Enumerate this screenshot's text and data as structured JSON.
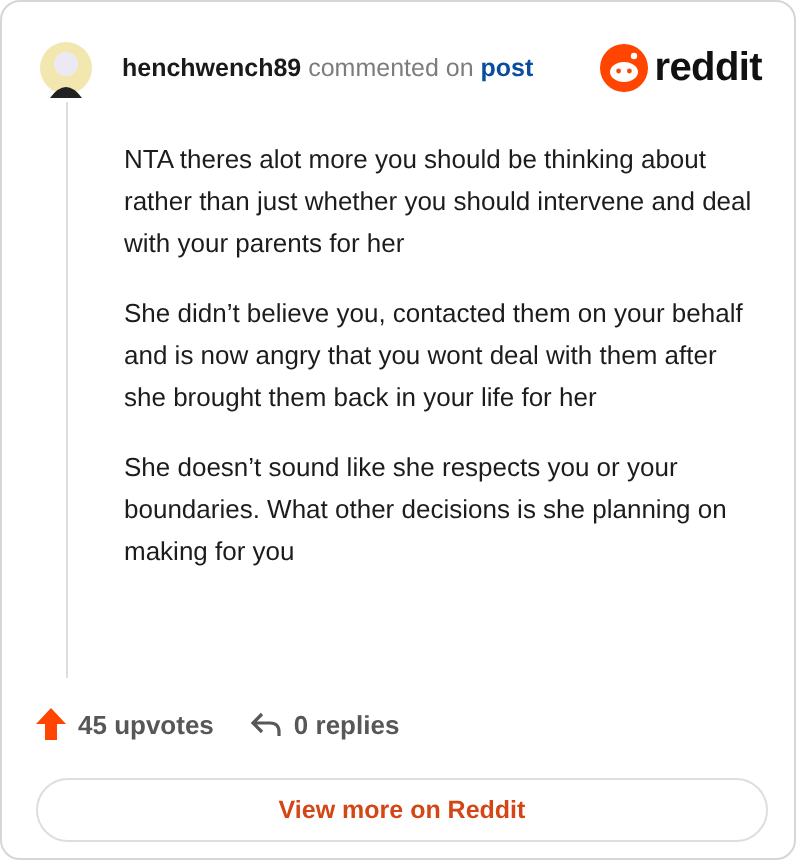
{
  "header": {
    "username": "henchwench89",
    "action": "commented on",
    "link": "post",
    "logo": "reddit"
  },
  "paragraphs": [
    "NTA theres alot more you should be thinking about rather than just whether you should intervene and deal with your parents for her",
    "She didn’t believe you, contacted them on your behalf and is now angry that you wont deal with them after she brought them back in your life for her",
    "She doesn’t sound like she respects you or your boundaries. What other decisions is she planning on making for you"
  ],
  "stats": {
    "upvotes": "45 upvotes",
    "replies": "0 replies"
  },
  "button": "View more on Reddit"
}
